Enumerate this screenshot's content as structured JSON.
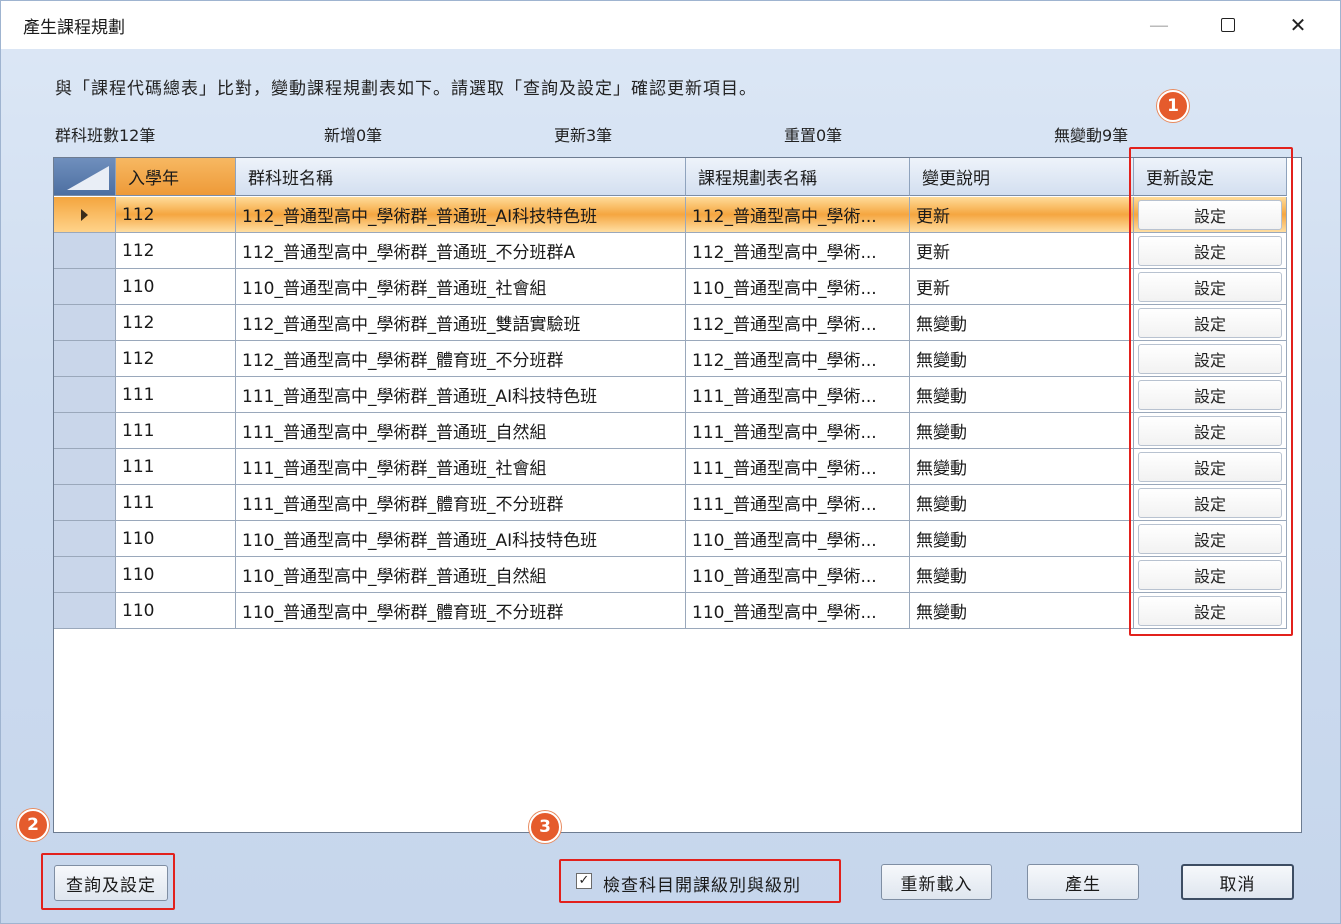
{
  "window": {
    "title": "產生課程規劃"
  },
  "description": "與「課程代碼總表」比對，變動課程規劃表如下。請選取「查詢及設定」確認更新項目。",
  "counts": {
    "total": "群科班數12筆",
    "added": "新增0筆",
    "updated": "更新3筆",
    "duplicate": "重置0筆",
    "unchanged": "無變動9筆"
  },
  "grid": {
    "columns": [
      "入學年",
      "群科班名稱",
      "課程規劃表名稱",
      "變更說明",
      "更新設定"
    ],
    "rows": [
      {
        "year": "112",
        "name": "112_普通型高中_學術群_普通班_AI科技特色班",
        "plan": "112_普通型高中_學術...",
        "change": "更新",
        "action": "設定"
      },
      {
        "year": "112",
        "name": "112_普通型高中_學術群_普通班_不分班群A",
        "plan": "112_普通型高中_學術...",
        "change": "更新",
        "action": "設定"
      },
      {
        "year": "110",
        "name": "110_普通型高中_學術群_普通班_社會組",
        "plan": "110_普通型高中_學術...",
        "change": "更新",
        "action": "設定"
      },
      {
        "year": "112",
        "name": "112_普通型高中_學術群_普通班_雙語實驗班",
        "plan": "112_普通型高中_學術...",
        "change": "無變動",
        "action": "設定"
      },
      {
        "year": "112",
        "name": "112_普通型高中_學術群_體育班_不分班群",
        "plan": "112_普通型高中_學術...",
        "change": "無變動",
        "action": "設定"
      },
      {
        "year": "111",
        "name": "111_普通型高中_學術群_普通班_AI科技特色班",
        "plan": "111_普通型高中_學術...",
        "change": "無變動",
        "action": "設定"
      },
      {
        "year": "111",
        "name": "111_普通型高中_學術群_普通班_自然組",
        "plan": "111_普通型高中_學術...",
        "change": "無變動",
        "action": "設定"
      },
      {
        "year": "111",
        "name": "111_普通型高中_學術群_普通班_社會組",
        "plan": "111_普通型高中_學術...",
        "change": "無變動",
        "action": "設定"
      },
      {
        "year": "111",
        "name": "111_普通型高中_學術群_體育班_不分班群",
        "plan": "111_普通型高中_學術...",
        "change": "無變動",
        "action": "設定"
      },
      {
        "year": "110",
        "name": "110_普通型高中_學術群_普通班_AI科技特色班",
        "plan": "110_普通型高中_學術...",
        "change": "無變動",
        "action": "設定"
      },
      {
        "year": "110",
        "name": "110_普通型高中_學術群_普通班_自然組",
        "plan": "110_普通型高中_學術...",
        "change": "無變動",
        "action": "設定"
      },
      {
        "year": "110",
        "name": "110_普通型高中_學術群_體育班_不分班群",
        "plan": "110_普通型高中_學術...",
        "change": "無變動",
        "action": "設定"
      }
    ]
  },
  "footer": {
    "query_button": "查詢及設定",
    "check_label": "檢查科目開課級別與級別",
    "reload_button": "重新載入",
    "generate_button": "產生",
    "cancel_button": "取消"
  },
  "badges": [
    "1",
    "2",
    "3"
  ],
  "colors": {
    "highlight": "#e2211c",
    "badge": "#e55b2c",
    "active_row": "#f5a640"
  }
}
